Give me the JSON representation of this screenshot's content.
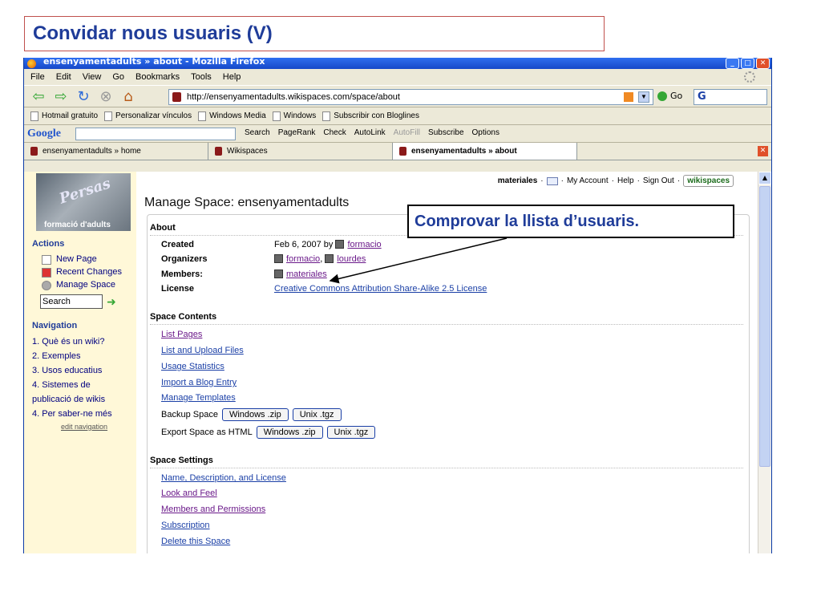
{
  "slide": {
    "title": "Convidar nous usuaris (V)",
    "callout": "Comprovar la llista d’usuaris."
  },
  "browser": {
    "title": "ensenyamentadults » about - Mozilla Firefox",
    "menu": [
      "File",
      "Edit",
      "View",
      "Go",
      "Bookmarks",
      "Tools",
      "Help"
    ],
    "url": "http://ensenyamentadults.wikispaces.com/space/about",
    "go_label": "Go",
    "search_value": "G",
    "bookmarks": [
      "Hotmail gratuito",
      "Personalizar vínculos",
      "Windows Media",
      "Windows",
      "Subscribir con Bloglines"
    ],
    "google_toolbar": {
      "logo": "Google",
      "items": [
        "Search",
        "PageRank",
        "Check",
        "AutoLink",
        "AutoFill",
        "Subscribe",
        "Options"
      ]
    },
    "tabs": [
      {
        "label": "ensenyamentadults » home"
      },
      {
        "label": "Wikispaces"
      },
      {
        "label": "ensenyamentadults » about"
      }
    ]
  },
  "site": {
    "logo_text": "formació d'adults",
    "logo_script": "Persas",
    "top_links": {
      "user": "materiales",
      "my_account": "My Account",
      "help": "Help",
      "sign_out": "Sign Out",
      "wikispaces": "wikispaces"
    },
    "sidebar": {
      "actions_heading": "Actions",
      "actions": [
        "New Page",
        "Recent Changes",
        "Manage Space"
      ],
      "search_value": "Search",
      "navigation_heading": "Navigation",
      "navigation": [
        "1. Què és un wiki?",
        "2. Exemples",
        "3. Usos educatius",
        "4. Sistemes de",
        "publicació de wikis",
        "4. Per saber-ne més"
      ],
      "edit_navigation": "edit navigation"
    },
    "page_title": "Manage Space: ensenyamentadults",
    "about": {
      "heading": "About",
      "created_label": "Created",
      "created_value": "Feb 6, 2007 by",
      "created_user": "formacio",
      "organizers_label": "Organizers",
      "organizers": [
        "formacio",
        "lourdes"
      ],
      "members_label": "Members:",
      "members": "materiales",
      "license_label": "License",
      "license_value": "Creative Commons Attribution Share-Alike 2.5 License"
    },
    "contents": {
      "heading": "Space Contents",
      "links": [
        "List Pages",
        "List and Upload Files",
        "Usage Statistics",
        "Import a Blog Entry",
        "Manage Templates"
      ],
      "backup_label": "Backup Space",
      "export_label": "Export Space as HTML",
      "windows_zip": "Windows .zip",
      "unix_tgz": "Unix .tgz"
    },
    "settings": {
      "heading": "Space Settings",
      "links": [
        "Name, Description, and License",
        "Look and Feel",
        "Members and Permissions",
        "Subscription",
        "Delete this Space"
      ]
    }
  }
}
